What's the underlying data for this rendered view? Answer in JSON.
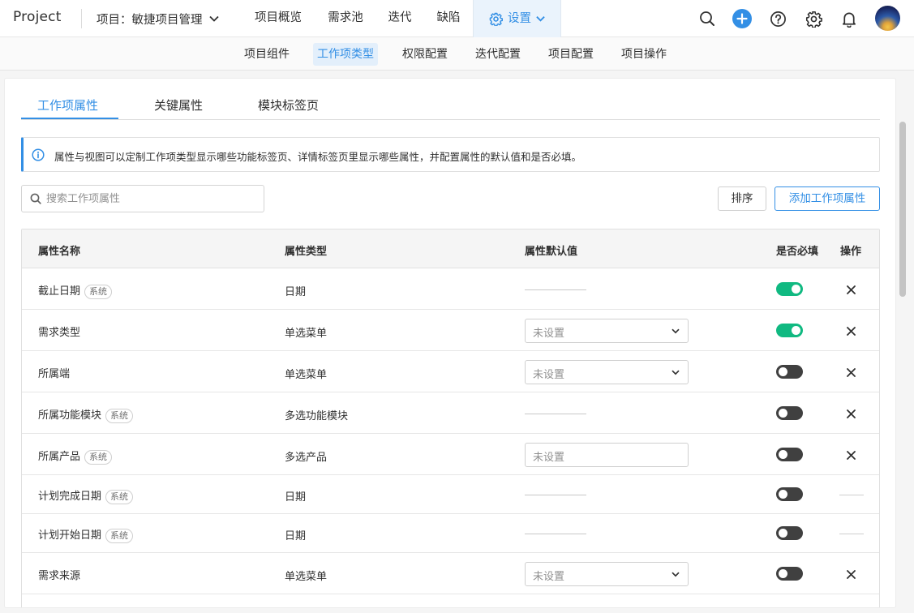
{
  "app": {
    "brand": "Project",
    "project_selector": "项目：敏捷项目管理"
  },
  "topnav": {
    "items": [
      "项目概览",
      "需求池",
      "迭代",
      "缺陷"
    ],
    "active": "设置"
  },
  "subnav": {
    "items": [
      "项目组件",
      "工作项类型",
      "权限配置",
      "迭代配置",
      "项目配置",
      "项目操作"
    ],
    "active_index": 1
  },
  "tabs": {
    "items": [
      "工作项属性",
      "关键属性",
      "模块标签页"
    ],
    "active_index": 0
  },
  "notice": {
    "text": "属性与视图可以定制工作项类型显示哪些功能标签页、详情标签页里显示哪些属性，并配置属性的默认值和是否必填。"
  },
  "search": {
    "placeholder": "搜索工作项属性",
    "value": ""
  },
  "actions": {
    "sort_label": "排序",
    "add_label": "添加工作项属性"
  },
  "table": {
    "columns": [
      "属性名称",
      "属性类型",
      "属性默认值",
      "是否必填",
      "操作"
    ],
    "system_tag": "系统",
    "select_placeholder": "未设置",
    "rows": [
      {
        "name": "截止日期",
        "system": true,
        "type": "日期",
        "default": "none",
        "required": true,
        "deletable": true
      },
      {
        "name": "需求类型",
        "system": false,
        "type": "单选菜单",
        "default": "select",
        "required": true,
        "deletable": true
      },
      {
        "name": "所属端",
        "system": false,
        "type": "单选菜单",
        "default": "select",
        "required": false,
        "deletable": true
      },
      {
        "name": "所属功能模块",
        "system": true,
        "type": "多选功能模块",
        "default": "none",
        "required": false,
        "deletable": true
      },
      {
        "name": "所属产品",
        "system": true,
        "type": "多选产品",
        "default": "input",
        "required": false,
        "deletable": true
      },
      {
        "name": "计划完成日期",
        "system": true,
        "type": "日期",
        "default": "none",
        "required": false,
        "deletable": false
      },
      {
        "name": "计划开始日期",
        "system": true,
        "type": "日期",
        "default": "none",
        "required": false,
        "deletable": false
      },
      {
        "name": "需求来源",
        "system": false,
        "type": "单选菜单",
        "default": "select",
        "required": false,
        "deletable": true
      }
    ]
  },
  "colors": {
    "accent": "#338fe5",
    "toggle_on": "#10b981",
    "toggle_off": "#404040"
  }
}
